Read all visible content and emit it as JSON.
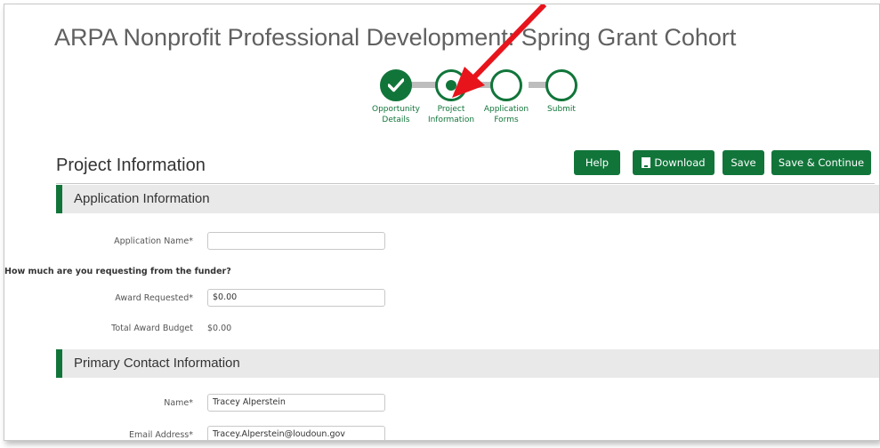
{
  "opportunity": {
    "title": "ARPA Nonprofit Professional Development: Spring Grant Cohort"
  },
  "stepper": {
    "steps": [
      {
        "label_line1": "Opportunity",
        "label_line2": "Details",
        "state": "complete"
      },
      {
        "label_line1": "Project",
        "label_line2": "Information",
        "state": "current"
      },
      {
        "label_line1": "Application",
        "label_line2": "Forms",
        "state": "pending"
      },
      {
        "label_line1": "Submit",
        "label_line2": "",
        "state": "pending"
      }
    ]
  },
  "page": {
    "heading": "Project Information"
  },
  "toolbar": {
    "help_label": "Help",
    "download_label": "Download",
    "save_label": "Save",
    "save_continue_label": "Save & Continue"
  },
  "application_info": {
    "section_title": "Application Information",
    "app_name_label": "Application Name*",
    "app_name_value": "",
    "question": "How much are you requesting from the funder?",
    "award_requested_label": "Award Requested*",
    "award_requested_value": "$0.00",
    "total_award_label": "Total Award Budget",
    "total_award_value": "$0.00"
  },
  "primary_contact": {
    "section_title": "Primary Contact Information",
    "name_label": "Name*",
    "name_value": "Tracey Alperstein",
    "email_label": "Email Address*",
    "email_value": "Tracey.Alperstein@loudoun.gov"
  },
  "colors": {
    "accent": "#11753a",
    "annotation_arrow": "#e8141c"
  }
}
